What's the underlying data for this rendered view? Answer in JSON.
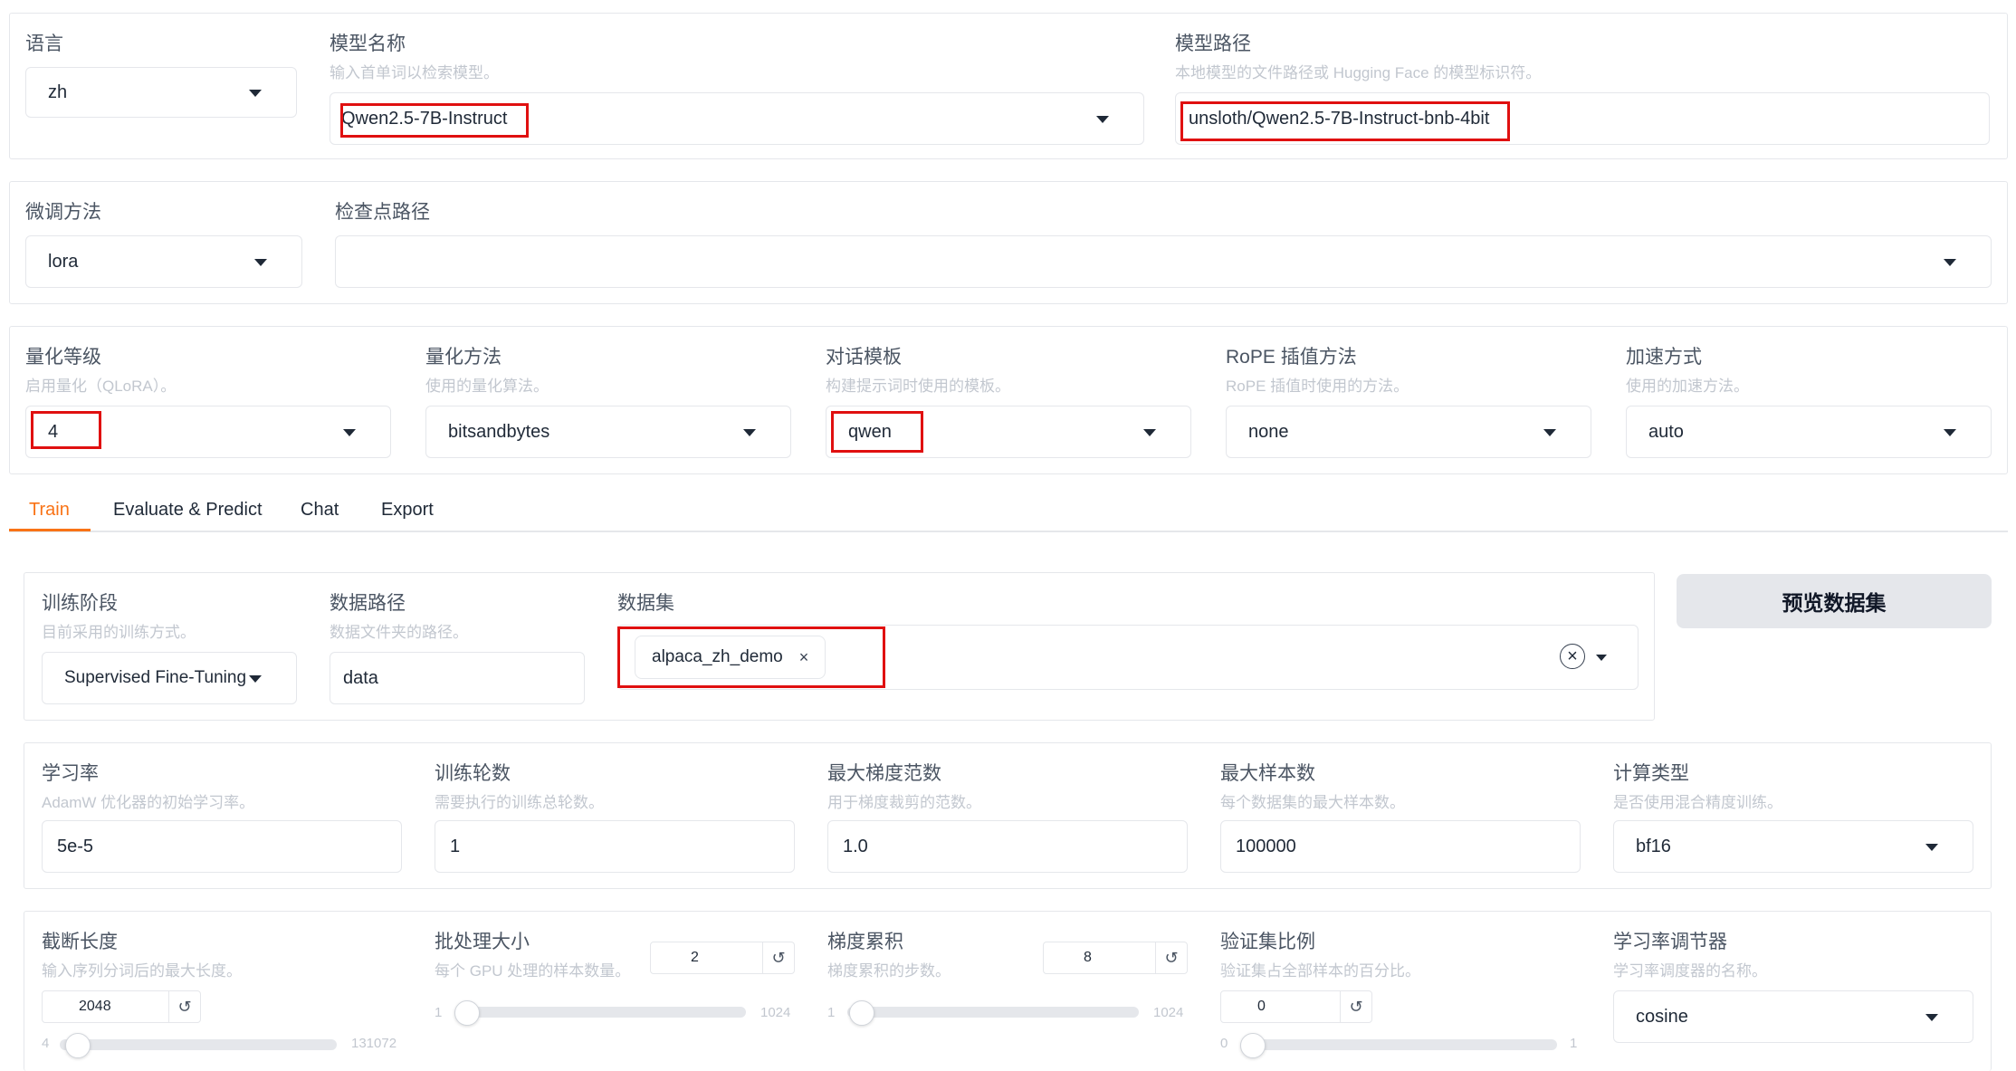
{
  "top": {
    "lang": {
      "label": "语言",
      "value": "zh"
    },
    "model_name": {
      "label": "模型名称",
      "info": "输入首单词以检索模型。",
      "value": "Qwen2.5-7B-Instruct"
    },
    "model_path": {
      "label": "模型路径",
      "info": "本地模型的文件路径或 Hugging Face 的模型标识符。",
      "value": "unsloth/Qwen2.5-7B-Instruct-bnb-4bit"
    }
  },
  "row2": {
    "finetune": {
      "label": "微调方法",
      "value": "lora"
    },
    "checkpoint": {
      "label": "检查点路径",
      "value": ""
    }
  },
  "row3": {
    "quant_bit": {
      "label": "量化等级",
      "info": "启用量化（QLoRA）。",
      "value": "4"
    },
    "quant_method": {
      "label": "量化方法",
      "info": "使用的量化算法。",
      "value": "bitsandbytes"
    },
    "template": {
      "label": "对话模板",
      "info": "构建提示词时使用的模板。",
      "value": "qwen"
    },
    "rope": {
      "label": "RoPE 插值方法",
      "info": "RoPE 插值时使用的方法。",
      "value": "none"
    },
    "booster": {
      "label": "加速方式",
      "info": "使用的加速方法。",
      "value": "auto"
    }
  },
  "tabs": [
    "Train",
    "Evaluate & Predict",
    "Chat",
    "Export"
  ],
  "train": {
    "stage": {
      "label": "训练阶段",
      "info": "目前采用的训练方式。",
      "value": "Supervised Fine-Tuning"
    },
    "dataset_dir": {
      "label": "数据路径",
      "info": "数据文件夹的路径。",
      "value": "data"
    },
    "dataset": {
      "label": "数据集",
      "chip": "alpaca_zh_demo",
      "chip_close": "×",
      "clear": "×"
    },
    "preview_button": "预览数据集"
  },
  "row5": {
    "lr": {
      "label": "学习率",
      "info": "AdamW 优化器的初始学习率。",
      "value": "5e-5"
    },
    "epochs": {
      "label": "训练轮数",
      "info": "需要执行的训练总轮数。",
      "value": "1"
    },
    "max_grad_norm": {
      "label": "最大梯度范数",
      "info": "用于梯度裁剪的范数。",
      "value": "1.0"
    },
    "max_samples": {
      "label": "最大样本数",
      "info": "每个数据集的最大样本数。",
      "value": "100000"
    },
    "compute_type": {
      "label": "计算类型",
      "info": "是否使用混合精度训练。",
      "value": "bf16"
    }
  },
  "row6": {
    "cutoff": {
      "label": "截断长度",
      "info": "输入序列分词后的最大长度。",
      "value": "2048",
      "min": "4",
      "max": "131072",
      "level": 0.015
    },
    "batch_size": {
      "label": "批处理大小",
      "info": "每个 GPU 处理的样本数量。",
      "value": "2",
      "min": "1",
      "max": "1024",
      "level": 0.001
    },
    "grad_accum": {
      "label": "梯度累积",
      "info": "梯度累积的步数。",
      "value": "8",
      "min": "1",
      "max": "1024",
      "level": 0.007
    },
    "val_size": {
      "label": "验证集比例",
      "info": "验证集占全部样本的百分比。",
      "value": "0",
      "min": "0",
      "max": "1",
      "level": 0
    },
    "scheduler": {
      "label": "学习率调节器",
      "info": "学习率调度器的名称。",
      "value": "cosine"
    }
  },
  "icons": {
    "reset": "↺"
  },
  "colors": {
    "accent": "#f97316",
    "highlight": "#e01010"
  }
}
